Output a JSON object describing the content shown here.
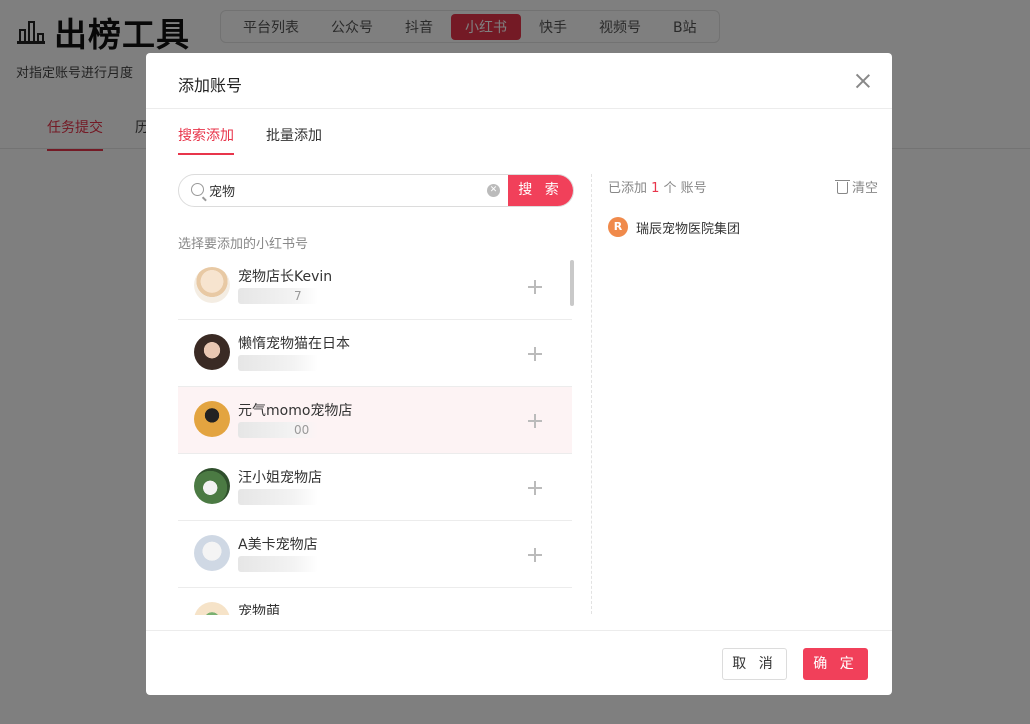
{
  "app": {
    "title": "出榜工具",
    "subtitle": "对指定账号进行月度",
    "platforms": [
      "平台列表",
      "公众号",
      "抖音",
      "小红书",
      "快手",
      "视频号",
      "B站"
    ],
    "active_platform_index": 3,
    "page_tabs": [
      "任务提交",
      "历"
    ]
  },
  "modal": {
    "title": "添加账号",
    "tabs": {
      "search": "搜索添加",
      "batch": "批量添加"
    },
    "search": {
      "value": "宠物",
      "button": "搜 索"
    },
    "list_label": "选择要添加的小红书号",
    "results": [
      {
        "name": "宠物店长Kevin",
        "sub": "7"
      },
      {
        "name": "懒惰宠物猫在日本",
        "sub": ""
      },
      {
        "name": "元气momo宠物店",
        "sub": "00"
      },
      {
        "name": "汪小姐宠物店",
        "sub": ""
      },
      {
        "name": "A美卡宠物店",
        "sub": ""
      },
      {
        "name": "宠物萌",
        "sub": ""
      }
    ],
    "added": {
      "prefix": "已添加 ",
      "count": "1",
      "suffix": " 个 账号",
      "clear_label": "清空",
      "items": [
        {
          "name": "瑞辰宠物医院集团"
        }
      ]
    },
    "footer": {
      "cancel": "取 消",
      "confirm": "确 定"
    }
  },
  "colors": {
    "accent": "#f1405a",
    "overlay": "rgba(0,0,0,0.5)"
  }
}
